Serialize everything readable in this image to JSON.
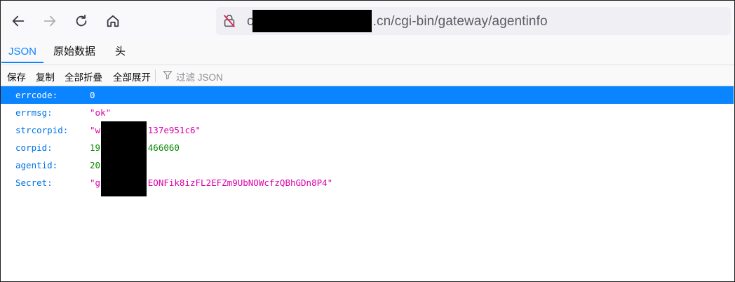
{
  "browser": {
    "url_prefix": "c",
    "url_suffix": ".cn/cgi-bin/gateway/agentinfo"
  },
  "tabs": [
    "JSON",
    "原始数据",
    "头"
  ],
  "actions": {
    "save": "保存",
    "copy": "复制",
    "collapse_all": "全部折叠",
    "expand_all": "全部展开",
    "filter_placeholder": "过滤 JSON"
  },
  "json_rows": [
    {
      "key": "errcode:",
      "value": "0"
    },
    {
      "key": "errmsg:",
      "value": "\"ok\""
    },
    {
      "key": "strcorpid:",
      "value": "\"w         137e951c6\""
    },
    {
      "key": "corpid:",
      "value": "19         466060"
    },
    {
      "key": "agentid:",
      "value": "20"
    },
    {
      "key": "Secret:",
      "value": "\"g         EONFik8izFL2EFZm9UbNOWcfzQBhGDn8P4\""
    }
  ],
  "colors": {
    "accent": "#0a84ff",
    "json_key": "#0074e8",
    "json_string": "#dd00a9",
    "json_number": "#058b00"
  }
}
